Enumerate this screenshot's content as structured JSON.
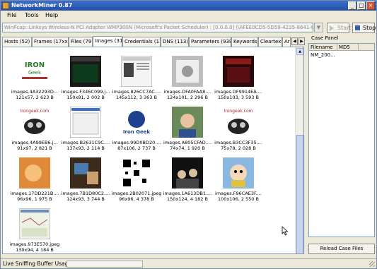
{
  "window": {
    "title": "NetworkMiner 0.87"
  },
  "menu": [
    "File",
    "Tools",
    "Help"
  ],
  "adapter": {
    "value": "WinPcap: Linksys Wireless-N PCI Adapter WMP300N (Microsoft's Packet Scheduler) : [0.0.0.0] (\\AFEE0CD5-5D59-4235-8641-6E59B0C184FA)"
  },
  "toolbar": {
    "start_label": "Start",
    "stop_label": "Stop"
  },
  "tabs": [
    "Hosts (52)",
    "Frames (17xxx)",
    "Files (79)",
    "Images (31)",
    "Credentials (17)",
    "DNS (113)",
    "Parameters (939)",
    "Keywords",
    "Cleartext",
    "Ar"
  ],
  "images": [
    {
      "name": "images.4A32293D...",
      "size": "121x57, 2 623 B",
      "icon": "irongeek-logo"
    },
    {
      "name": "images.F346C099.j...",
      "size": "150x81, 2 002 B",
      "icon": "dark-screenshot"
    },
    {
      "name": "images.826CC7AC....",
      "size": "145x112, 3 363 B",
      "icon": "webpage-screenshot"
    },
    {
      "name": "images.DFA0FAA8....",
      "size": "124x101, 2 296 B",
      "icon": "photo-grey"
    },
    {
      "name": "images.DF9914EA....",
      "size": "150x103, 3 593 B",
      "icon": "red-webpage"
    },
    {
      "name": "images.4A99EB6.j...",
      "size": "91x97, 2 821 B",
      "icon": "irongeek-robot"
    },
    {
      "name": "images.B2631C9C....",
      "size": "137x93, 2 114 B",
      "icon": "window-screenshot"
    },
    {
      "name": "images.99D0BD20....",
      "size": "87x106, 2 737 B",
      "icon": "irongeek-badge"
    },
    {
      "name": "images.A805CFAD....",
      "size": "74x74, 1 920 B",
      "icon": "person-photo"
    },
    {
      "name": "images.B3CC3F35....",
      "size": "75x78, 2 028 B",
      "icon": "irongeek-robot"
    },
    {
      "name": "images.17DD221B....",
      "size": "96x96, 1 975 B",
      "icon": "orange-photo"
    },
    {
      "name": "images.7B1D80C2....",
      "size": "124x93, 3 744 B",
      "icon": "desk-photo"
    },
    {
      "name": "images.2B02071.jpeg",
      "size": "96x96, 4 378 B",
      "icon": "qr-code"
    },
    {
      "name": "images.1A613DB1....",
      "size": "150x124, 4 182 B",
      "icon": "crowd-photo"
    },
    {
      "name": "images.F96CAE3F....",
      "size": "100x106, 2 550 B",
      "icon": "cartoon-character"
    },
    {
      "name": "images.973E570.jpeg",
      "size": "130x94, 4 184 B",
      "icon": "map-screenshot"
    }
  ],
  "case_panel": {
    "label": "Case Panel",
    "columns": [
      "Filename",
      "MD5"
    ],
    "rows": [
      {
        "filename": "NM_200...",
        "md5": ""
      }
    ],
    "reload_label": "Reload Case Files"
  },
  "status": {
    "label": "Live Sniffing Buffer Usage:"
  },
  "colors": {
    "titlebar": "#2450a8",
    "window_bg": "#ece9d8"
  }
}
